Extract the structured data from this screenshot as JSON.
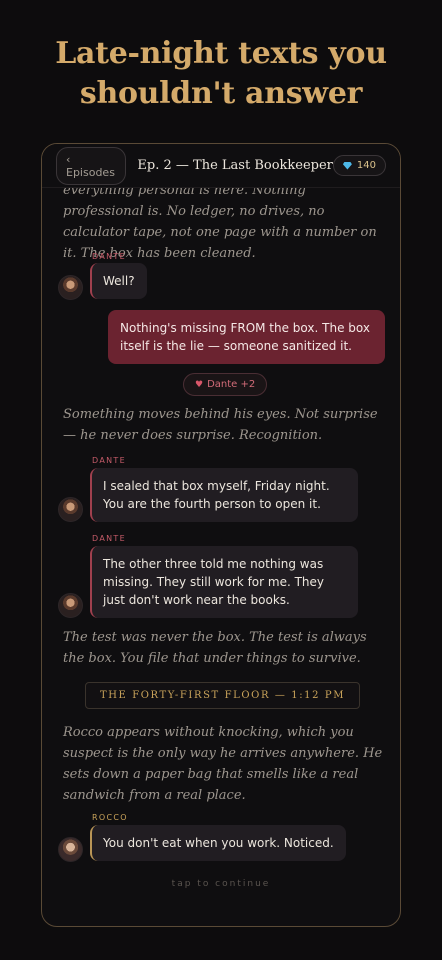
{
  "headline": {
    "line1": "Late-night texts you",
    "line2": "shouldn't answer"
  },
  "topbar": {
    "back_label": "‹ Episodes",
    "episode_title": "Ep. 2 — The Last Bookkeeper",
    "gems": "140"
  },
  "story": {
    "narration_1": "everything personal is here. Nothing professional is. No ledger, no drives, no calculator tape, not one page with a number on it. The box has been cleaned.",
    "msg1_speaker": "DANTE",
    "msg1_text": "Well?",
    "player_text": "Nothing's missing FROM the box. The box itself is the lie — someone sanitized it.",
    "affinity_label": "Dante +2",
    "narration_2": "Something moves behind his eyes. Not surprise — he never does surprise. Recognition.",
    "msg2_speaker": "DANTE",
    "msg2_text": "I sealed that box myself, Friday night. You are the fourth person to open it.",
    "msg3_speaker": "DANTE",
    "msg3_text": "The other three told me nothing was missing. They still work for me. They just don't work near the books.",
    "narration_3": "The test was never the box. The test is always the box. You file that under things to survive.",
    "scene_marker": "THE FORTY-FIRST FLOOR — 1:12 PM",
    "narration_4": "Rocco appears without knocking, which you suspect is the only way he arrives anywhere. He sets down a paper bag that smells like a real sandwich from a real place.",
    "msg4_speaker": "ROCCO",
    "msg4_text": "You don't eat when you work. Noticed.",
    "tap_hint": "tap to continue"
  },
  "colors": {
    "accent_gold": "#d4aa6a",
    "accent_red": "#a0404e",
    "player_bubble": "#6b2330"
  }
}
